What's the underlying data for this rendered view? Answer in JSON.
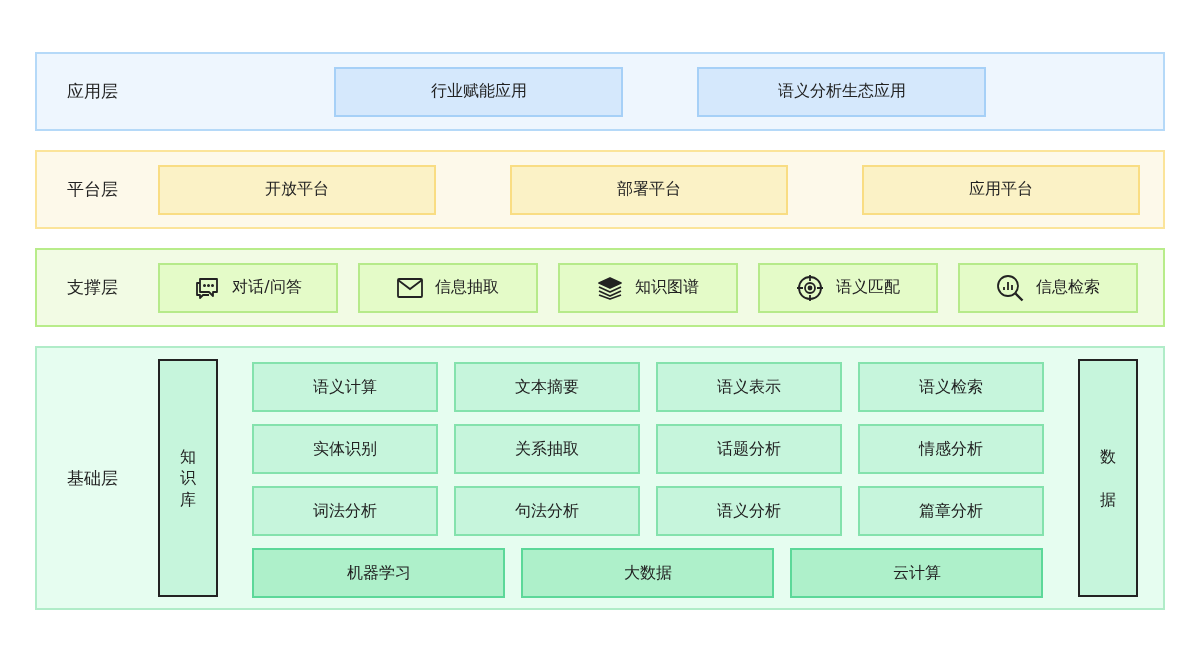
{
  "application_layer": {
    "label": "应用层",
    "items": [
      "行业赋能应用",
      "语义分析生态应用"
    ]
  },
  "platform_layer": {
    "label": "平台层",
    "items": [
      "开放平台",
      "部署平台",
      "应用平台"
    ]
  },
  "support_layer": {
    "label": "支撑层",
    "items": [
      {
        "label": "对话/问答",
        "kind": "chat"
      },
      {
        "label": "信息抽取",
        "kind": "mail"
      },
      {
        "label": "知识图谱",
        "kind": "layers"
      },
      {
        "label": "语义匹配",
        "kind": "target"
      },
      {
        "label": "信息检索",
        "kind": "search"
      }
    ]
  },
  "foundation_layer": {
    "label": "基础层",
    "left_column": "知识库",
    "right_column": "数据",
    "grid": [
      "语义计算",
      "文本摘要",
      "语义表示",
      "语义检索",
      "实体识别",
      "关系抽取",
      "话题分析",
      "情感分析",
      "词法分析",
      "句法分析",
      "语义分析",
      "篇章分析"
    ],
    "bottom_row": [
      "机器学习",
      "大数据",
      "云计算"
    ]
  }
}
